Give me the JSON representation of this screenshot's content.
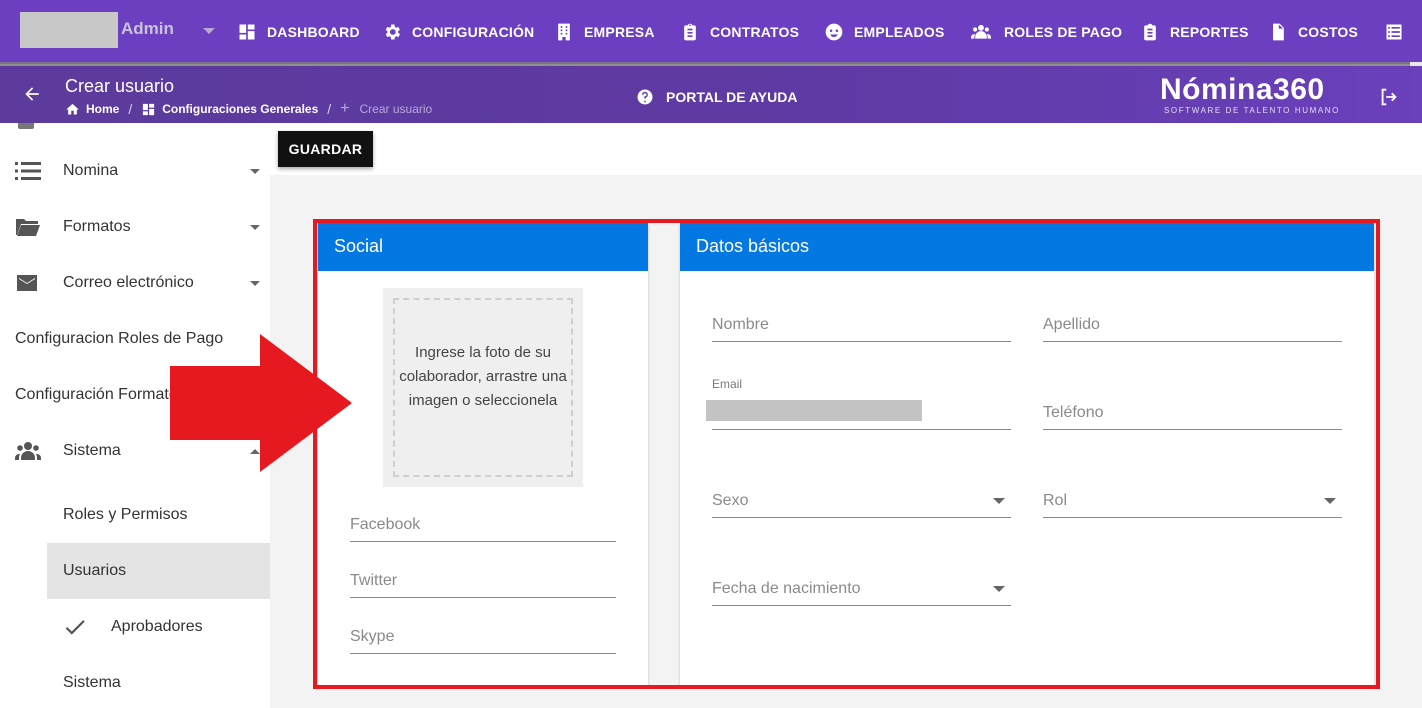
{
  "topnav": {
    "user": {
      "name": "Admin"
    },
    "items": [
      {
        "label": "DASHBOARD",
        "icon": "dashboard-icon"
      },
      {
        "label": "CONFIGURACIÓN",
        "icon": "gear-icon"
      },
      {
        "label": "EMPRESA",
        "icon": "building-icon"
      },
      {
        "label": "CONTRATOS",
        "icon": "clipboard-icon"
      },
      {
        "label": "EMPLEADOS",
        "icon": "face-icon"
      },
      {
        "label": "ROLES DE PAGO",
        "icon": "people-icon"
      },
      {
        "label": "REPORTES",
        "icon": "report-icon"
      },
      {
        "label": "COSTOS",
        "icon": "dollar-file-icon"
      }
    ],
    "more_icon": "list-icon"
  },
  "subheader": {
    "title": "Crear usuario",
    "breadcrumb": [
      "Home",
      "Configuraciones Generales",
      "Crear usuario"
    ],
    "help_label": "PORTAL DE AYUDA",
    "brand_name": "Nómina360",
    "brand_tagline": "SOFTWARE DE TALENTO HUMANO"
  },
  "sidebar": {
    "items": [
      {
        "label": "Nomina",
        "icon": "list-icon"
      },
      {
        "label": "Formatos",
        "icon": "folder-icon"
      },
      {
        "label": "Correo electrónico",
        "icon": "mail-icon"
      },
      {
        "label": "Configuracion Roles de Pago"
      },
      {
        "label": "Configuración Formatos"
      },
      {
        "label": "Sistema",
        "icon": "people-icon"
      },
      {
        "label": "Roles y Permisos"
      },
      {
        "label": "Usuarios"
      },
      {
        "label": "Aprobadores",
        "icon": "check-icon"
      },
      {
        "label": "Sistema"
      }
    ]
  },
  "toolbar": {
    "save_label": "GUARDAR"
  },
  "social_card": {
    "title": "Social",
    "dropzone_text": "Ingrese la foto de su colaborador, arrastre una imagen o seleccionela",
    "fields": {
      "facebook": "Facebook",
      "twitter": "Twitter",
      "skype": "Skype"
    }
  },
  "basics_card": {
    "title": "Datos básicos",
    "fields": {
      "nombre": "Nombre",
      "apellido": "Apellido",
      "email_label": "Email",
      "telefono": "Teléfono",
      "sexo": "Sexo",
      "rol": "Rol",
      "fecha_nacimiento": "Fecha de nacimiento"
    }
  },
  "colors": {
    "nav": "#6b3fbf",
    "card_header": "#0478e2",
    "annotation": "#e5191f"
  }
}
